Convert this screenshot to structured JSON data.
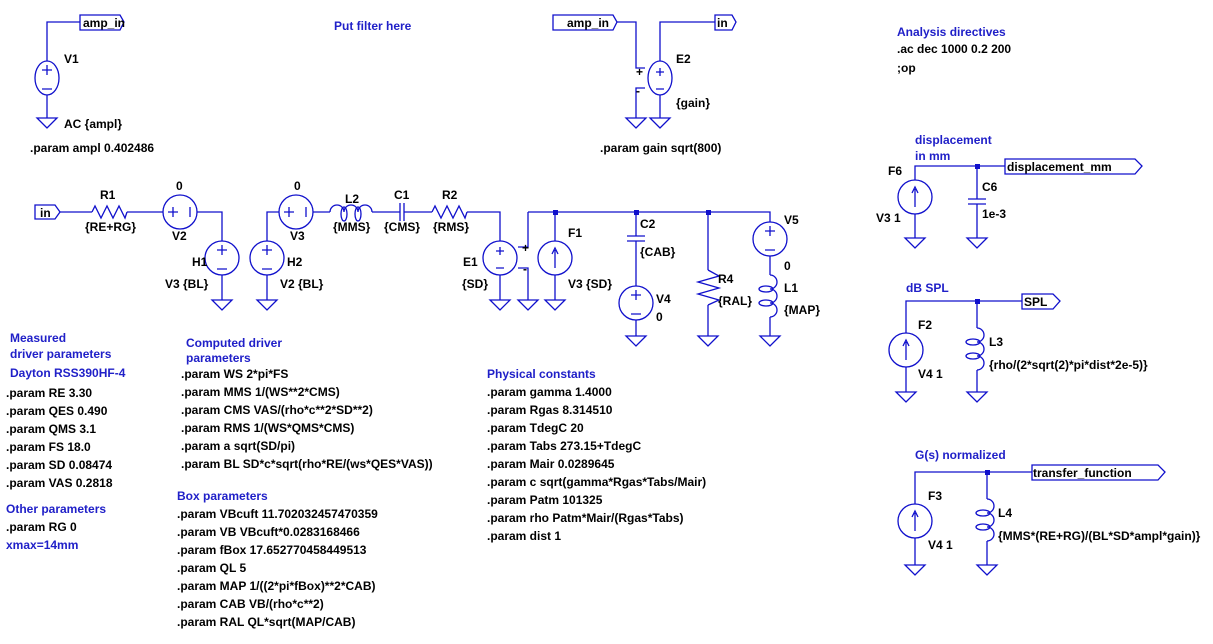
{
  "colors": {
    "wire": "#1010cc",
    "comment": "#2020c8",
    "text": "#000000",
    "background": "#ffffff"
  },
  "top": {
    "put_filter": "Put filter here",
    "v1": {
      "name": "V1",
      "value": "AC {ampl}",
      "net": "amp_in"
    },
    "ampl_param": ".param ampl 0.402486",
    "e2": {
      "name": "E2",
      "value": "{gain}",
      "in_net": "amp_in",
      "out_net": "in",
      "plus": "+",
      "minus": "-"
    },
    "gain_param": ".param gain sqrt(800)"
  },
  "analysis": {
    "title": "Analysis directives",
    "lines": [
      ".ac dec 1000 0.2 200",
      ";op"
    ]
  },
  "main": {
    "in_net": "in",
    "r1": {
      "name": "R1",
      "value": "{RE+RG}"
    },
    "v2": {
      "name": "V2",
      "value": "0"
    },
    "h1": {
      "name": "H1",
      "value": "V3 {BL}"
    },
    "h2": {
      "name": "H2",
      "value": "V2 {BL}"
    },
    "v3": {
      "name": "V3",
      "value": "0"
    },
    "l2": {
      "name": "L2",
      "value": "{MMS}"
    },
    "c1": {
      "name": "C1",
      "value": "{CMS}"
    },
    "r2": {
      "name": "R2",
      "value": "{RMS}"
    },
    "e1": {
      "name": "E1",
      "value": "{SD}",
      "plus": "+",
      "minus": "-"
    },
    "f1": {
      "name": "F1",
      "value": "V3 {SD}"
    },
    "c2": {
      "name": "C2",
      "value": "{CAB}"
    },
    "v4": {
      "name": "V4",
      "value": "0"
    },
    "r4": {
      "name": "R4",
      "value": "{RAL}"
    },
    "v5": {
      "name": "V5",
      "value": "0"
    },
    "l1": {
      "name": "L1",
      "value": "{MAP}"
    }
  },
  "displacement": {
    "title1": "displacement",
    "title2": "in mm",
    "f6": {
      "name": "F6",
      "value": "V3 1"
    },
    "c6": {
      "name": "C6",
      "value": "1e-3"
    },
    "net": "displacement_mm"
  },
  "spl": {
    "title": "dB SPL",
    "f2": {
      "name": "F2",
      "value": "V4 1"
    },
    "l3": {
      "name": "L3",
      "value": "{rho/(2*sqrt(2)*pi*dist*2e-5)}"
    },
    "net": "SPL"
  },
  "gs": {
    "title": "G(s) normalized",
    "f3": {
      "name": "F3",
      "value": "V4 1"
    },
    "l4": {
      "name": "L4",
      "value": "{MMS*(RE+RG)/(BL*SD*ampl*gain)}"
    },
    "net": "transfer_function"
  },
  "measured": {
    "title1": "Measured",
    "title2": "driver parameters",
    "driver": "Dayton RSS390HF-4",
    "params": [
      ".param RE 3.30",
      ".param QES 0.490",
      ".param QMS 3.1",
      ".param FS 18.0",
      ".param SD 0.08474",
      ".param VAS 0.2818"
    ]
  },
  "other": {
    "title": "Other parameters",
    "params": [
      ".param RG 0"
    ],
    "note": "xmax=14mm"
  },
  "computed": {
    "title1": "Computed driver",
    "title2": "parameters",
    "params": [
      ".param WS 2*pi*FS",
      ".param MMS 1/(WS**2*CMS)",
      ".param CMS VAS/(rho*c**2*SD**2)",
      ".param RMS 1/(WS*QMS*CMS)",
      ".param a sqrt(SD/pi)",
      ".param BL SD*c*sqrt(rho*RE/(ws*QES*VAS))"
    ]
  },
  "box": {
    "title": "Box parameters",
    "params": [
      ".param VBcuft 11.702032457470359",
      ".param VB VBcuft*0.0283168466",
      ".param fBox 17.652770458449513",
      ".param QL 5",
      ".param MAP 1/((2*pi*fBox)**2*CAB)",
      ".param CAB VB/(rho*c**2)",
      ".param RAL QL*sqrt(MAP/CAB)"
    ]
  },
  "physical": {
    "title": "Physical constants",
    "params": [
      ".param gamma 1.4000",
      ".param Rgas 8.314510",
      ".param TdegC 20",
      ".param Tabs 273.15+TdegC",
      ".param Mair 0.0289645",
      ".param c sqrt(gamma*Rgas*Tabs/Mair)",
      ".param Patm 101325",
      ".param rho Patm*Mair/(Rgas*Tabs)",
      ".param dist 1"
    ]
  }
}
